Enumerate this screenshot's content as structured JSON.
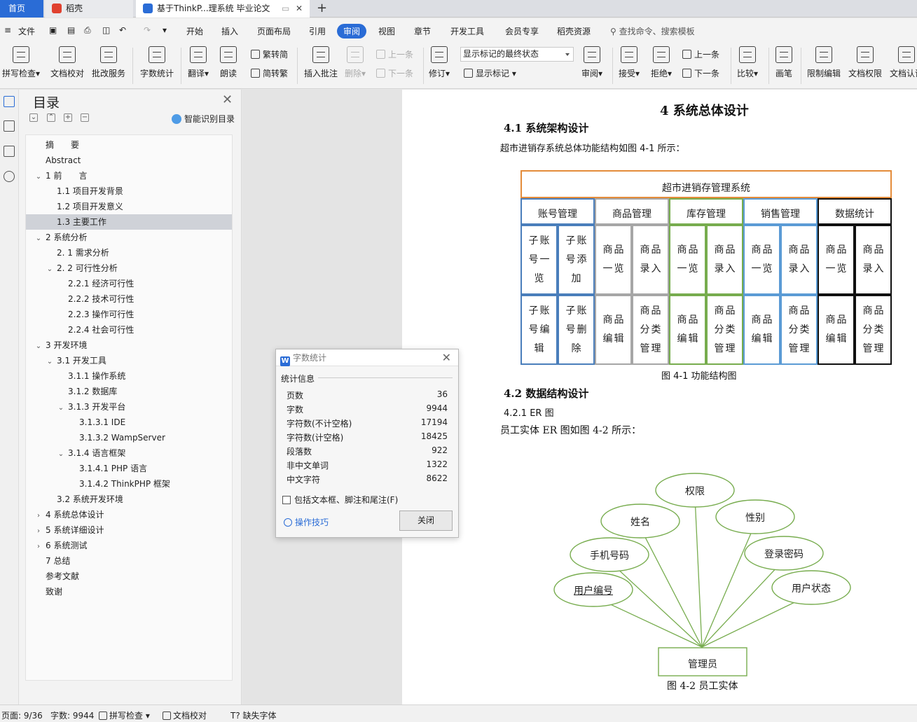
{
  "tabs": {
    "home": "首页",
    "daoke": "稻壳",
    "doc": "基于ThinkP...理系统 毕业论文"
  },
  "menu": {
    "file": "文件",
    "items": [
      "开始",
      "插入",
      "页面布局",
      "引用"
    ],
    "active": "审阅",
    "items_after": [
      "视图",
      "章节",
      "开发工具",
      "会员专享",
      "稻壳资源"
    ],
    "search": "查找命令、搜索模板"
  },
  "ribbon": {
    "spell": "拼写检查",
    "proof": "文档校对",
    "grade": "批改服务",
    "count": "字数统计",
    "translate": "翻译",
    "read": "朗读",
    "to_trad": "繁转简",
    "to_simp": "简转繁",
    "insert_comment": "插入批注",
    "delete": "删除",
    "prev_comment": "上一条",
    "next_comment": "下一条",
    "track": "修订",
    "markup_select": "显示标记的最终状态",
    "show_markup": "显示标记",
    "review": "审阅",
    "accept": "接受",
    "reject": "拒绝",
    "prev": "上一条",
    "next": "下一条",
    "compare": "比较",
    "pen": "画笔",
    "restrict": "限制编辑",
    "perm": "文档权限",
    "cert": "文档认证"
  },
  "toc": {
    "title": "目录",
    "smart": "智能识别目录",
    "items": [
      {
        "text": "摘　　要"
      },
      {
        "text": "Abstract"
      },
      {
        "text": "1  前　　言"
      },
      {
        "text": "1.1  项目开发背景"
      },
      {
        "text": "1.2  项目开发意义"
      },
      {
        "text": "1.3  主要工作"
      },
      {
        "text": "2  系统分析"
      },
      {
        "text": "2. 1  需求分析"
      },
      {
        "text": "2. 2  可行性分析"
      },
      {
        "text": "2.2.1  经济可行性"
      },
      {
        "text": "2.2.2  技术可行性"
      },
      {
        "text": "2.2.3  操作可行性"
      },
      {
        "text": "2.2.4  社会可行性"
      },
      {
        "text": "3  开发环境"
      },
      {
        "text": "3.1  开发工具"
      },
      {
        "text": "3.1.1  操作系统"
      },
      {
        "text": "3.1.2  数据库"
      },
      {
        "text": "3.1.3  开发平台"
      },
      {
        "text": "3.1.3.1 IDE"
      },
      {
        "text": "3.1.3.2 WampServer"
      },
      {
        "text": "3.1.4  语言框架"
      },
      {
        "text": "3.1.4.1 PHP 语言"
      },
      {
        "text": "3.1.4.2 ThinkPHP 框架"
      },
      {
        "text": "3.2  系统开发环境"
      },
      {
        "text": "4  系统总体设计"
      },
      {
        "text": "5  系统详细设计"
      },
      {
        "text": "6  系统测试"
      },
      {
        "text": "7  总结"
      },
      {
        "text": "参考文献"
      },
      {
        "text": "致谢"
      }
    ]
  },
  "document": {
    "chapter": "4  系统总体设计",
    "s41": "4.1  系统架构设计",
    "p1": "超市进销存系统总体功能结构如图 4-1 所示：",
    "fig_root": "超市进销存管理系统",
    "fig_groups": [
      {
        "name": "账号管理",
        "color": "#4a7ebb",
        "cells": [
          "子账号一览",
          "子账号添加",
          "子账号编辑",
          "子账号删除"
        ]
      },
      {
        "name": "商品管理",
        "color": "#a6a6a6",
        "cells": [
          "商品一览",
          "商品录入",
          "商品编辑",
          "商品分类管理"
        ]
      },
      {
        "name": "库存管理",
        "color": "#77ac4e",
        "cells": [
          "商品一览",
          "商品录入",
          "商品编辑",
          "商品分类管理"
        ]
      },
      {
        "name": "销售管理",
        "color": "#5b9bd5",
        "cells": [
          "商品一览",
          "商品录入",
          "商品编辑",
          "商品分类管理"
        ]
      },
      {
        "name": "数据统计",
        "color": "#111111",
        "cells": [
          "商品一览",
          "商品录入",
          "商品编辑",
          "商品分类管理"
        ]
      }
    ],
    "fig1_caption": "图 4-1  功能结构图",
    "s42": "4.2  数据结构设计",
    "s421": "4.2.1 ER 图",
    "p2": "员工实体 ER 图如图 4-2 所示：",
    "er_entity": "管理员",
    "er_attrs": [
      "权限",
      "姓名",
      "性别",
      "手机号码",
      "登录密码",
      "用户编号",
      "用户状态"
    ],
    "fig2_caption": "图 4-2  员工实体"
  },
  "wordcount": {
    "title": "字数统计",
    "section": "统计信息",
    "rows": [
      {
        "label": "页数",
        "value": "36"
      },
      {
        "label": "字数",
        "value": "9944"
      },
      {
        "label": "字符数(不计空格)",
        "value": "17194"
      },
      {
        "label": "字符数(计空格)",
        "value": "18425"
      },
      {
        "label": "段落数",
        "value": "922"
      },
      {
        "label": "非中文单词",
        "value": "1322"
      },
      {
        "label": "中文字符",
        "value": "8622"
      }
    ],
    "include": "包括文本框、脚注和尾注(F)",
    "tips": "操作技巧",
    "close": "关闭"
  },
  "status": {
    "page": "页面: 9/36",
    "words": "字数: 9944",
    "spell": "拼写检查",
    "proof": "文档校对",
    "font": "缺失字体"
  },
  "colors": {
    "accent": "#2a6cd6",
    "orange_border": "#e48c3a",
    "er_green": "#77ac4e"
  }
}
